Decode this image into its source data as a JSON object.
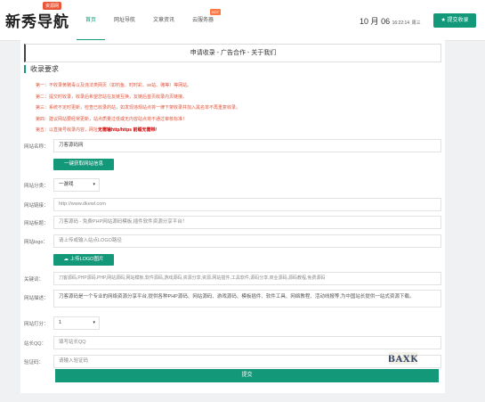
{
  "header": {
    "logo_text": "新秀导航",
    "logo_badge": "资源网",
    "nav": [
      {
        "label": "首页",
        "active": true,
        "hot": ""
      },
      {
        "label": "网址导航",
        "active": false,
        "hot": ""
      },
      {
        "label": "文章资讯",
        "active": false,
        "hot": ""
      },
      {
        "label": "云服务器",
        "active": false,
        "hot": "HOT"
      }
    ],
    "date": {
      "month": "10",
      "month_unit": "月",
      "day": "06",
      "time": "16:22:14",
      "weekday": "周三"
    },
    "submit_label": "提交收录"
  },
  "page": {
    "title": "申请收录 - 广告合作 - 关于我们",
    "section_title": "收录要求",
    "rules": [
      {
        "text": "第一：不收录黄赌毒以及违法类网页（如钓鱼、时时彩、av站、赌等）等网站。",
        "emph": ""
      },
      {
        "text": "第二：提交时收录，收录后希望您站在友链互换，友链后首页收录内页链接。",
        "emph": ""
      },
      {
        "text": "第三：系统不定时更新，检查已收录的站，如发现违规站点将一律下架收录并加入黑名单不再重复收录。",
        "emph": ""
      },
      {
        "text": "第四：建议网站要经常更新，站点质量过低或无内容站点将不通过审核标准！",
        "emph": ""
      },
      {
        "text": "第五：以直接号收录内容，网址",
        "emph": "无需输http/https 前缀无需带/"
      }
    ]
  },
  "form": {
    "site_name": {
      "label": "网站名称：",
      "value": "刀客源码网"
    },
    "fetch_button": "一键获取网站信息",
    "category": {
      "label": "网站分类：",
      "value": "一游戏"
    },
    "link": {
      "label": "网站链接：",
      "placeholder": "http://www.dkewl.com"
    },
    "description": {
      "label": "网站标题：",
      "value": "刀客源码 - 免费PHP网站源码模板,插件软件资源分享平台！"
    },
    "logo": {
      "label": "网站logo：",
      "placeholder": "请上传或输入站点LOGO路径"
    },
    "upload_button": "上传LOGO图片",
    "keywords": {
      "label": "关键词：",
      "value": "刀客源码,PHP源码,PHP,网站源码,网站模板,软件源码,游戏源码,资源分享,资源,网站插件,工具软件,源码分享,商业源码,源码教程,免费源码"
    },
    "site_desc": {
      "label": "网站描述：",
      "value": "刀客源码是一个专业的网络资源分享平台,提供各种PHP源码、网站源码、游戏源码、模板插件、软件工具、网络教程、活动线报等,为中国站长提供一站式资源下载。"
    },
    "rating": {
      "label": "网站打分：",
      "value": "1"
    },
    "qq": {
      "label": "站长QQ：",
      "placeholder": "填写站长QQ"
    },
    "captcha": {
      "label": "验证码：",
      "placeholder": "请输入验证码",
      "code": "BAXK"
    },
    "submit_label": "提交"
  }
}
